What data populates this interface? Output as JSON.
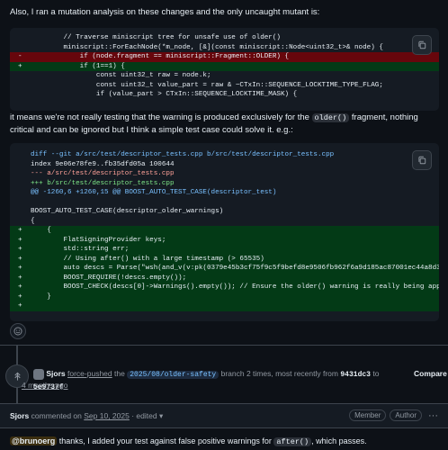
{
  "intro": "Also, I ran a mutation analysis on these changes and the only uncaught mutant is:",
  "mutant_code": [
    {
      "type": "ctx",
      "gutter": "",
      "text": "        // Traverse miniscript tree for unsafe use of older()"
    },
    {
      "type": "ctx",
      "gutter": "",
      "text": "        miniscript::ForEachNode(*m_node, [&](const miniscript::Node<uint32_t>& node) {"
    },
    {
      "type": "del",
      "gutter": "-",
      "text": "            if (node.fragment == miniscript::Fragment::OLDER) {"
    },
    {
      "type": "add",
      "gutter": "+",
      "text": "            if (1==1) {"
    },
    {
      "type": "ctx",
      "gutter": "",
      "text": "                const uint32_t raw = node.k;"
    },
    {
      "type": "ctx",
      "gutter": "",
      "text": "                const uint32_t value_part = raw & ~CTxIn::SEQUENCE_LOCKTIME_TYPE_FLAG;"
    },
    {
      "type": "ctx",
      "gutter": "",
      "text": "                if (value_part > CTxIn::SEQUENCE_LOCKTIME_MASK) {"
    }
  ],
  "para2": {
    "before": "it means we're not really testing that the warning is produced exclusively for the ",
    "code": "older()",
    "after": " fragment, nothing critical and can be ignored but I think a simple test case could solve it. e.g.:"
  },
  "diff_code": [
    {
      "type": "meta",
      "cls": "c-blue",
      "gutter": "",
      "text": "diff --git a/src/test/descriptor_tests.cpp b/src/test/descriptor_tests.cpp"
    },
    {
      "type": "meta",
      "cls": "",
      "gutter": "",
      "text": "index 9e06e78fe9..fb35dfd05a 100644"
    },
    {
      "type": "meta",
      "cls": "c-red",
      "gutter": "",
      "text": "--- a/src/test/descriptor_tests.cpp"
    },
    {
      "type": "meta",
      "cls": "c-green",
      "gutter": "",
      "text": "+++ b/src/test/descriptor_tests.cpp"
    },
    {
      "type": "meta",
      "cls": "c-hunk",
      "gutter": "",
      "text": "@@ -1260,6 +1260,15 @@ BOOST_AUTO_TEST_CASE(descriptor_test)"
    },
    {
      "type": "ctx",
      "cls": "",
      "gutter": "",
      "text": ""
    },
    {
      "type": "ctx",
      "cls": "",
      "gutter": "",
      "text": "BOOST_AUTO_TEST_CASE(descriptor_older_warnings)"
    },
    {
      "type": "ctx",
      "cls": "",
      "gutter": "",
      "text": "{"
    },
    {
      "type": "add",
      "cls": "",
      "gutter": "+",
      "text": "    {"
    },
    {
      "type": "add",
      "cls": "",
      "gutter": "+",
      "text": "        FlatSigningProvider keys;"
    },
    {
      "type": "add",
      "cls": "",
      "gutter": "+",
      "text": "        std::string err;"
    },
    {
      "type": "add",
      "cls": "",
      "gutter": "+",
      "text": "        // Using after() with a large timestamp (> 65535)"
    },
    {
      "type": "add",
      "cls": "",
      "gutter": "+",
      "text": "        auto descs = Parse(\"wsh(and_v(v:pk(0379e45b3cf75f9c5f9befd8e9506fb962f6a9d185ac87001ec44a8d3df8d4a9e3"
    },
    {
      "type": "add",
      "cls": "",
      "gutter": "+",
      "text": "        BOOST_REQUIRE(!descs.empty());"
    },
    {
      "type": "add",
      "cls": "",
      "gutter": "+",
      "text": "        BOOST_CHECK(descs[0]->Warnings().empty()); // Ensure the older() warning is really being applied only"
    },
    {
      "type": "add",
      "cls": "",
      "gutter": "+",
      "text": "    }"
    },
    {
      "type": "add",
      "cls": "",
      "gutter": "+",
      "text": ""
    }
  ],
  "event": {
    "user": "Sjors",
    "action": "force-pushed",
    "the": "the",
    "branch": "2025/08/older-safety",
    "mid": "branch 2 times, most recently from",
    "from_sha": "9431dc3",
    "to": "to",
    "to_sha": "5e9737f",
    "time": "4 months ago",
    "compare": "Compare"
  },
  "comment": {
    "user": "Sjors",
    "commented_on": "commented on",
    "date": "Sep 10, 2025",
    "edited": "edited",
    "badges": [
      "Member",
      "Author"
    ],
    "mention": "@brunoerg",
    "text_before": " thanks, I added your test against false positive warnings for ",
    "code": "after()",
    "text_after": ", which passes."
  },
  "colors": {
    "background": "#0d1117",
    "code_bg": "#151b23",
    "deleted_line": "#67060c",
    "added_line": "#033a16"
  }
}
